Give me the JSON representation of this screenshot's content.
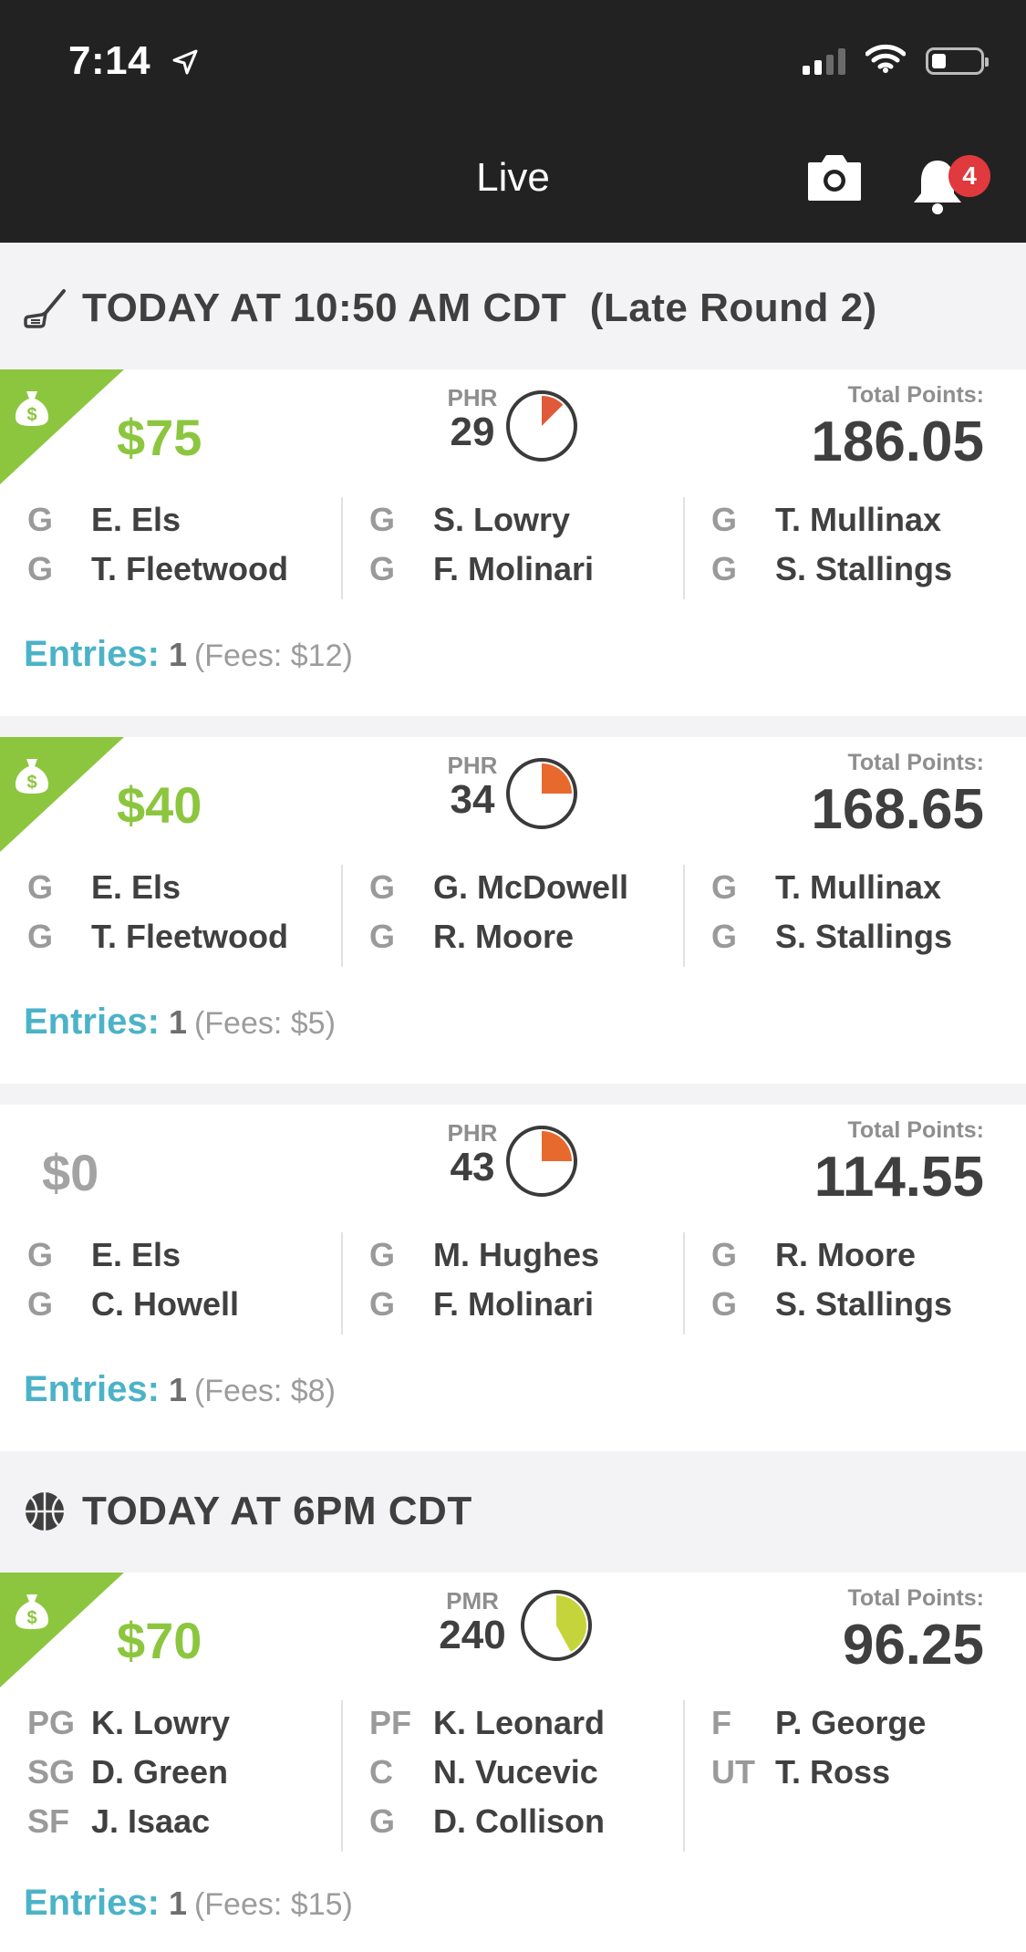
{
  "status": {
    "time": "7:14"
  },
  "header": {
    "title": "Live",
    "notification_count": "4"
  },
  "sections": [
    {
      "label": "TODAY AT 10:50 AM CDT  (Late Round 2)",
      "icon": "golf-club-icon"
    },
    {
      "label": "TODAY AT 6PM CDT",
      "icon": "basketball-icon"
    }
  ],
  "cards": [
    {
      "prize": "$75",
      "won": true,
      "remaining_label": "PHR",
      "remaining_value": "29",
      "progress_fraction": 0.125,
      "total_label": "Total Points:",
      "total_points": "186.05",
      "columns": [
        [
          {
            "pos": "G",
            "name": "E. Els"
          },
          {
            "pos": "G",
            "name": "T. Fleetwood"
          }
        ],
        [
          {
            "pos": "G",
            "name": "S. Lowry"
          },
          {
            "pos": "G",
            "name": "F. Molinari"
          }
        ],
        [
          {
            "pos": "G",
            "name": "T. Mullinax"
          },
          {
            "pos": "G",
            "name": "S. Stallings"
          }
        ]
      ],
      "entries_label": "Entries:",
      "entries_count": "1",
      "fees": "(Fees: $12)"
    },
    {
      "prize": "$40",
      "won": true,
      "remaining_label": "PHR",
      "remaining_value": "34",
      "progress_fraction": 0.25,
      "total_label": "Total Points:",
      "total_points": "168.65",
      "columns": [
        [
          {
            "pos": "G",
            "name": "E. Els"
          },
          {
            "pos": "G",
            "name": "T. Fleetwood"
          }
        ],
        [
          {
            "pos": "G",
            "name": "G. McDowell"
          },
          {
            "pos": "G",
            "name": "R. Moore"
          }
        ],
        [
          {
            "pos": "G",
            "name": "T. Mullinax"
          },
          {
            "pos": "G",
            "name": "S. Stallings"
          }
        ]
      ],
      "entries_label": "Entries:",
      "entries_count": "1",
      "fees": "(Fees: $5)"
    },
    {
      "prize": "$0",
      "won": false,
      "remaining_label": "PHR",
      "remaining_value": "43",
      "progress_fraction": 0.25,
      "total_label": "Total Points:",
      "total_points": "114.55",
      "columns": [
        [
          {
            "pos": "G",
            "name": "E. Els"
          },
          {
            "pos": "G",
            "name": "C. Howell"
          }
        ],
        [
          {
            "pos": "G",
            "name": "M. Hughes"
          },
          {
            "pos": "G",
            "name": "F. Molinari"
          }
        ],
        [
          {
            "pos": "G",
            "name": "R. Moore"
          },
          {
            "pos": "G",
            "name": "S. Stallings"
          }
        ]
      ],
      "entries_label": "Entries:",
      "entries_count": "1",
      "fees": "(Fees: $8)"
    },
    {
      "prize": "$70",
      "won": true,
      "remaining_label": "PMR",
      "remaining_value": "240",
      "progress_fraction": 0.42,
      "total_label": "Total Points:",
      "total_points": "96.25",
      "columns": [
        [
          {
            "pos": "PG",
            "name": "K. Lowry"
          },
          {
            "pos": "SG",
            "name": "D. Green"
          },
          {
            "pos": "SF",
            "name": "J. Isaac"
          }
        ],
        [
          {
            "pos": "PF",
            "name": "K. Leonard"
          },
          {
            "pos": "C",
            "name": "N. Vucevic"
          },
          {
            "pos": "G",
            "name": "D. Collison"
          }
        ],
        [
          {
            "pos": "F",
            "name": "P. George"
          },
          {
            "pos": "UT",
            "name": "T. Ross"
          }
        ]
      ],
      "entries_label": "Entries:",
      "entries_count": "1",
      "fees": "(Fees: $15)"
    }
  ],
  "colors": {
    "accent_green": "#8cc63f",
    "entries_teal": "#4bb3c7",
    "golf_progress": "#e8692e",
    "golf_progress_first": "#e05a3a",
    "basketball_progress": "#c5d43a",
    "badge_red": "#e0393e"
  }
}
